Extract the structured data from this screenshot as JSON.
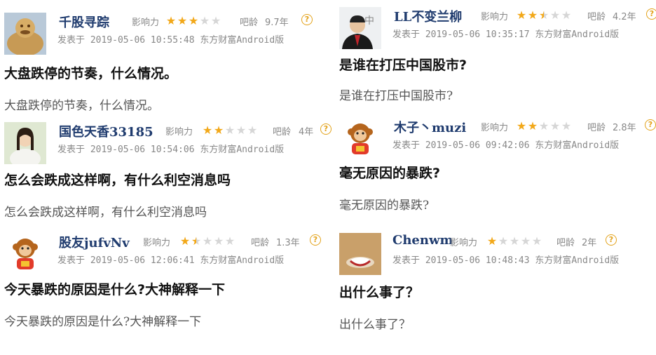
{
  "labels": {
    "influence": "影响力",
    "age": "吧龄",
    "help": "?"
  },
  "posts": [
    {
      "user": "千股寻踪",
      "age": "9.7年",
      "stars": 3,
      "posted": "发表于 2019-05-06 10:55:48 东方财富Android版",
      "title": "大盘跌停的节奏，什么情况。",
      "body": "大盘跌停的节奏，什么情况。",
      "avatar": "buddha-avatar"
    },
    {
      "user": "国色天香33185",
      "age": "4年",
      "stars": 2,
      "posted": "发表于 2019-05-06 10:54:06 东方财富Android版",
      "title": "怎么会跌成这样啊，有什么利空消息吗",
      "body": "怎么会跌成这样啊，有什么利空消息吗",
      "avatar": "woman-avatar"
    },
    {
      "user": "股友jufvNv",
      "age": "1.3年",
      "stars": 1.5,
      "posted": "发表于 2019-05-06 12:06:41 东方财富Android版",
      "title": "今天暴跌的原因是什么?大神解释一下",
      "body": "今天暴跌的原因是什么?大神解释一下",
      "avatar": "monkey-avatar"
    },
    {
      "user": "LL不变兰柳",
      "age": "4.2年",
      "stars": 2.5,
      "posted": "发表于 2019-05-06 10:35:17 东方财富Android版",
      "title": "是谁在打压中国股市?",
      "body": "是谁在打压中国股市?",
      "avatar": "man-avatar"
    },
    {
      "user": "木子丶muzi",
      "age": "2.8年",
      "stars": 2,
      "posted": "发表于 2019-05-06 09:42:06 东方财富Android版",
      "title": "毫无原因的暴跌?",
      "body": "毫无原因的暴跌?",
      "avatar": "monkey-avatar"
    },
    {
      "user": "Chenwm",
      "age": "2年",
      "stars": 1,
      "posted": "发表于 2019-05-06 10:48:43 东方财富Android版",
      "title": "出什么事了？",
      "body": "出什么事了？",
      "avatar": "object-avatar"
    }
  ],
  "colors": {
    "star": "#f2a819",
    "username": "#1f3b6e",
    "meta": "#888888"
  }
}
